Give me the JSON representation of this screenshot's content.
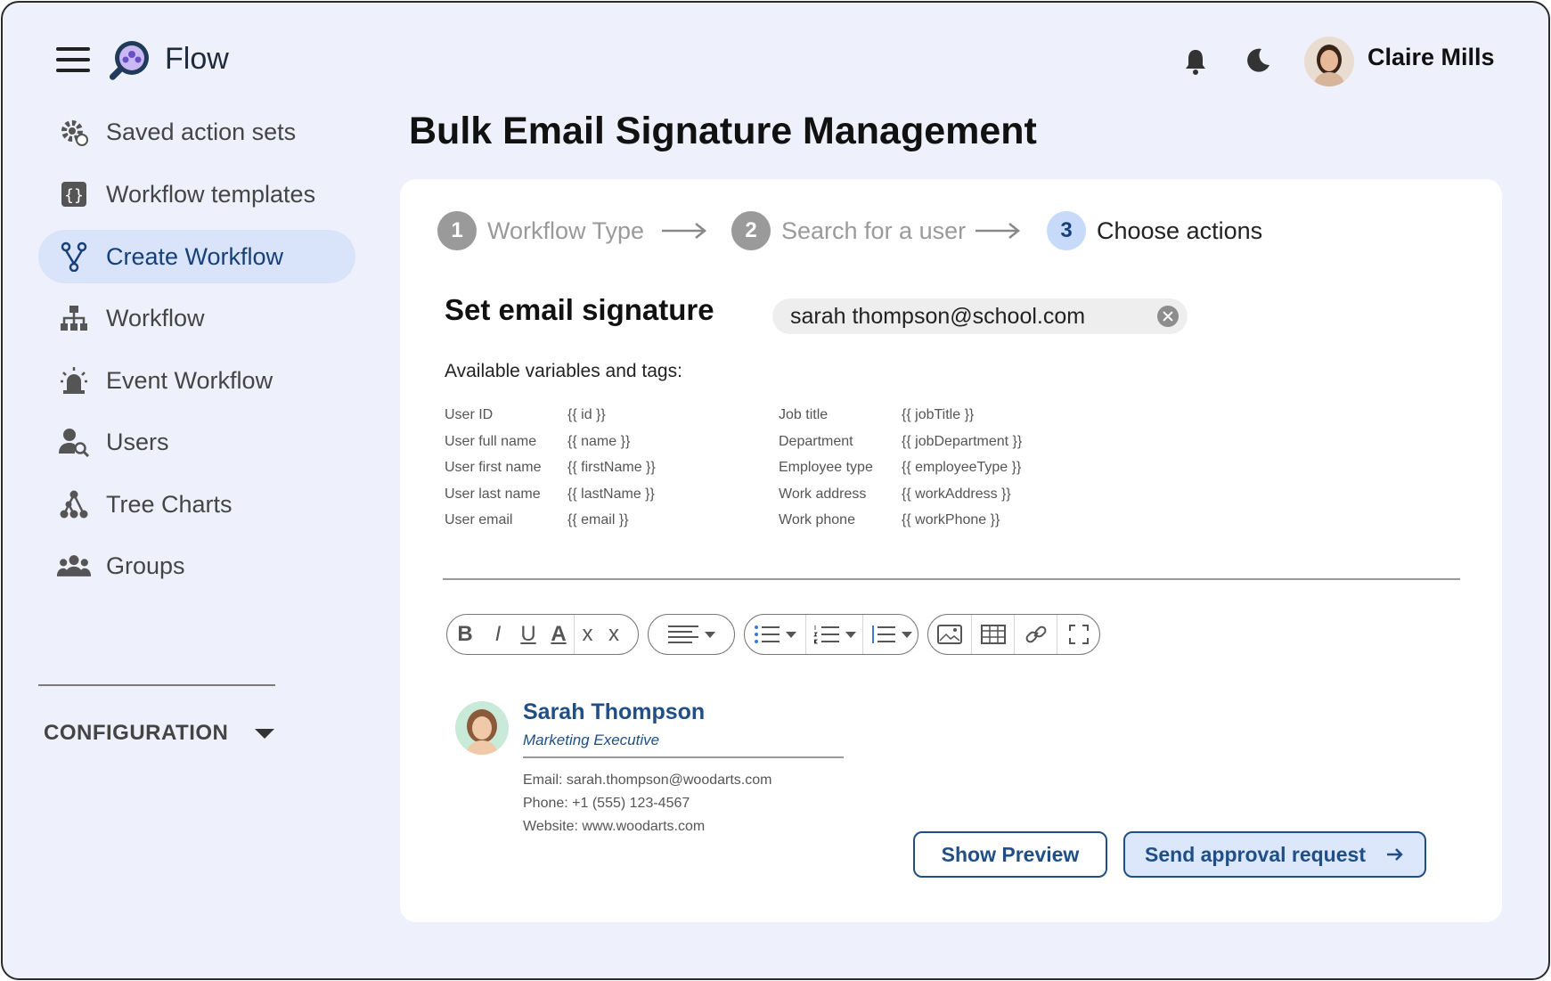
{
  "app": {
    "name": "Flow"
  },
  "header": {
    "user_name": "Claire Mills",
    "icons": [
      "menu-icon",
      "bell-icon",
      "moon-icon"
    ]
  },
  "sidebar": {
    "items": [
      {
        "label": "Saved action sets",
        "icon": "gear-refresh-icon"
      },
      {
        "label": "Workflow templates",
        "icon": "braces-icon"
      },
      {
        "label": "Create Workflow",
        "icon": "branch-icon",
        "active": true
      },
      {
        "label": "Workflow",
        "icon": "hierarchy-icon"
      },
      {
        "label": "Event Workflow",
        "icon": "alarm-icon"
      },
      {
        "label": "Users",
        "icon": "user-search-icon"
      },
      {
        "label": "Tree Charts",
        "icon": "tree-icon"
      },
      {
        "label": "Groups",
        "icon": "group-icon"
      }
    ],
    "config_label": "CONFIGURATION"
  },
  "page": {
    "title": "Bulk Email Signature Management"
  },
  "stepper": [
    {
      "num": "1",
      "label": "Workflow Type"
    },
    {
      "num": "2",
      "label": "Search for a user"
    },
    {
      "num": "3",
      "label": "Choose actions",
      "current": true
    }
  ],
  "section": {
    "title": "Set email signature",
    "email_value": "sarah thompson@school.com"
  },
  "variables": {
    "heading": "Available variables and tags:",
    "left": [
      {
        "label": "User ID",
        "tag": "{{ id }}"
      },
      {
        "label": "User full name",
        "tag": "{{ name }}"
      },
      {
        "label": "User first name",
        "tag": "{{ firstName }}"
      },
      {
        "label": "User last name",
        "tag": "{{ lastName }}"
      },
      {
        "label": "User email",
        "tag": "{{ email }}"
      }
    ],
    "right": [
      {
        "label": "Job title",
        "tag": "{{ jobTitle }}"
      },
      {
        "label": "Department",
        "tag": "{{ jobDepartment }}"
      },
      {
        "label": "Employee type",
        "tag": "{{ employeeType }}"
      },
      {
        "label": "Work address",
        "tag": "{{ workAddress }}"
      },
      {
        "label": "Work phone",
        "tag": "{{ workPhone }}"
      }
    ]
  },
  "toolbar": {
    "bold": "B",
    "italic": "I",
    "underline": "U",
    "font_color": "A",
    "clear_format": "x",
    "superscript": "x"
  },
  "signature": {
    "name": "Sarah Thompson",
    "role": "Marketing Executive",
    "email": "Email: sarah.thompson@woodarts.com",
    "phone": "Phone: +1 (555) 123-4567",
    "website": "Website: www.woodarts.com"
  },
  "actions": {
    "preview": "Show Preview",
    "send": "Send approval request"
  },
  "colors": {
    "accent": "#1f4f86",
    "active_bg": "#d9e4fb",
    "page_bg": "#eef1fb"
  }
}
